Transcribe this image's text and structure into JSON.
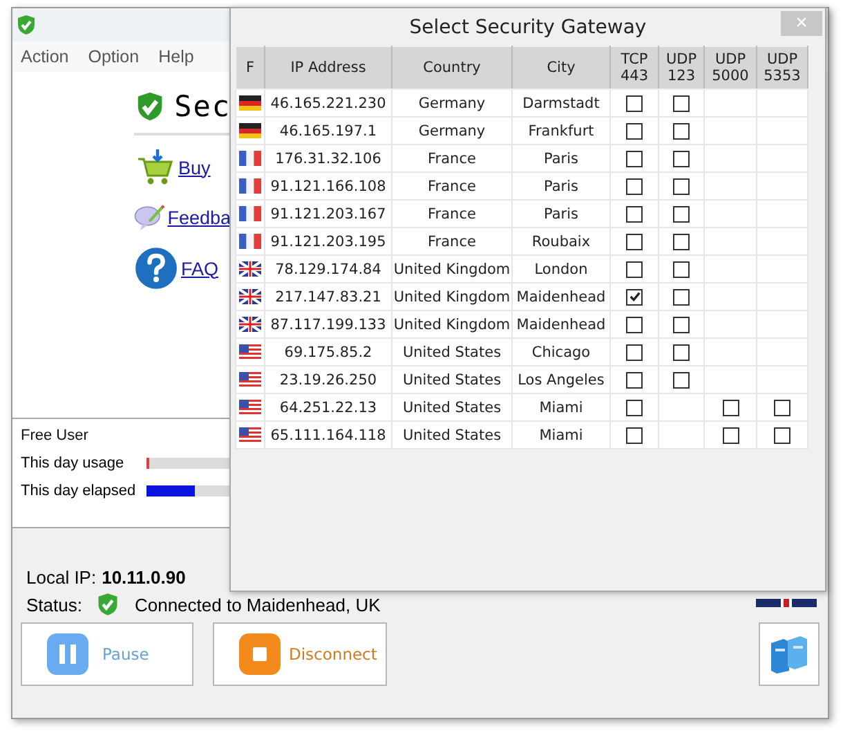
{
  "main_window": {
    "menu": [
      "Action",
      "Option",
      "Help"
    ],
    "logo_text": "Sec",
    "links": [
      {
        "kind": "cart",
        "label": "Buy"
      },
      {
        "kind": "feedback",
        "label": "Feedba"
      },
      {
        "kind": "help",
        "label": "FAQ"
      }
    ],
    "account": "Free User",
    "meters": [
      {
        "label": "This day usage",
        "level": 0.03,
        "color": "#e04040"
      },
      {
        "label": "This day elapsed",
        "level": 0.58,
        "color": "#0a14e0"
      }
    ],
    "local_ip_label": "Local IP:",
    "local_ip": "10.11.0.90",
    "status_label": "Status:",
    "status": "Connected to Maidenhead, UK",
    "buttons": [
      {
        "kind": "pause",
        "label": "Pause"
      },
      {
        "kind": "stop",
        "label": "Disconnect"
      }
    ]
  },
  "dialog": {
    "title": "Select Security Gateway",
    "close": "×",
    "columns": [
      "F",
      "IP Address",
      "Country",
      "City",
      "TCP 443",
      "UDP 123",
      "UDP 5000",
      "UDP 5353"
    ],
    "rows": [
      {
        "kind": "de",
        "ip": "46.165.221.230",
        "country": "Germany",
        "city": "Darmstadt",
        "tcp_443": false,
        "udp_123": false
      },
      {
        "kind": "de",
        "ip": "46.165.197.1",
        "country": "Germany",
        "city": "Frankfurt",
        "tcp_443": false,
        "udp_123": false
      },
      {
        "kind": "fr",
        "ip": "176.31.32.106",
        "country": "France",
        "city": "Paris",
        "tcp_443": false,
        "udp_123": false
      },
      {
        "kind": "fr",
        "ip": "91.121.166.108",
        "country": "France",
        "city": "Paris",
        "tcp_443": false,
        "udp_123": false
      },
      {
        "kind": "fr",
        "ip": "91.121.203.167",
        "country": "France",
        "city": "Paris",
        "tcp_443": false,
        "udp_123": false
      },
      {
        "kind": "fr",
        "ip": "91.121.203.195",
        "country": "France",
        "city": "Roubaix",
        "tcp_443": false,
        "udp_123": false
      },
      {
        "kind": "gb",
        "ip": "78.129.174.84",
        "country": "United Kingdom",
        "city": "London",
        "tcp_443": false,
        "udp_123": false
      },
      {
        "kind": "gb",
        "ip": "217.147.83.21",
        "country": "United Kingdom",
        "city": "Maidenhead",
        "tcp_443": true,
        "udp_123": false
      },
      {
        "kind": "gb",
        "ip": "87.117.199.133",
        "country": "United Kingdom",
        "city": "Maidenhead",
        "tcp_443": false,
        "udp_123": false
      },
      {
        "kind": "us",
        "ip": "69.175.85.2",
        "country": "United States",
        "city": "Chicago",
        "tcp_443": false,
        "udp_123": false
      },
      {
        "kind": "us",
        "ip": "23.19.26.250",
        "country": "United States",
        "city": "Los Angeles",
        "tcp_443": false,
        "udp_123": false
      },
      {
        "kind": "us",
        "ip": "64.251.22.13",
        "country": "United States",
        "city": "Miami",
        "tcp_443": false,
        "udp_5000": false,
        "udp_5353": false
      },
      {
        "kind": "us",
        "ip": "65.111.164.118",
        "country": "United States",
        "city": "Miami",
        "tcp_443": false,
        "udp_5000": false,
        "udp_5353": false
      }
    ]
  }
}
